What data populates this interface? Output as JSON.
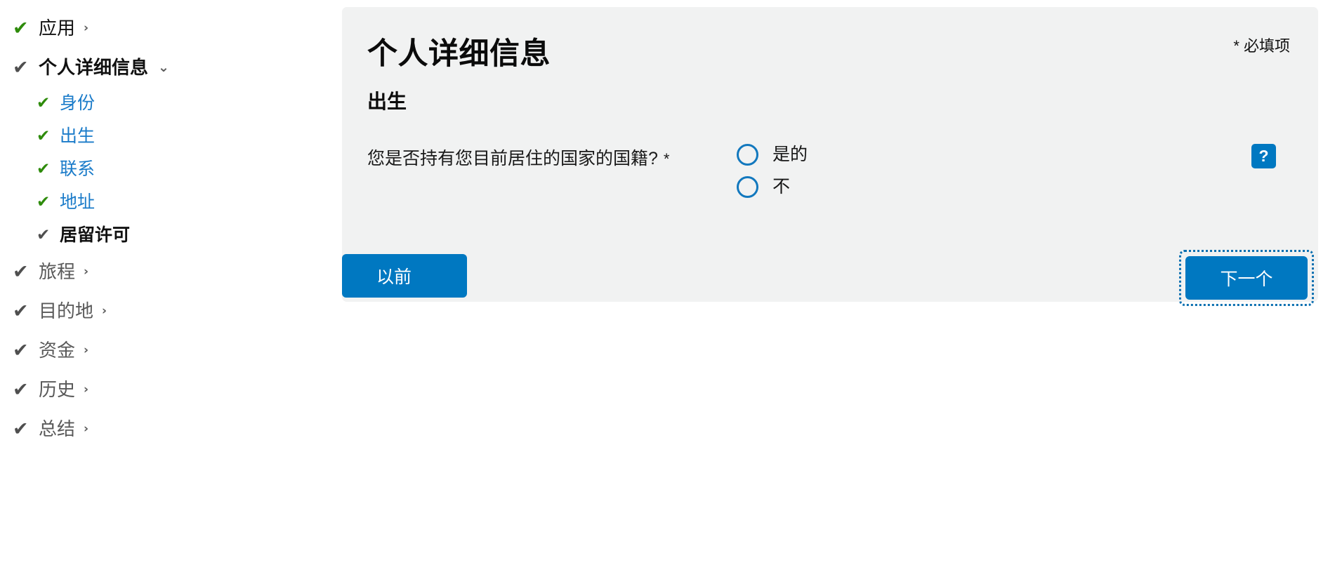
{
  "sidebar": {
    "items": [
      {
        "label": "应用",
        "check": "✔",
        "check_color": "green",
        "style": "dark",
        "chevron": "›",
        "level": 0
      },
      {
        "label": "个人详细信息",
        "check": "✔",
        "check_color": "grey",
        "style": "bold",
        "chevron": "⌄",
        "level": 0
      },
      {
        "label": "身份",
        "check": "✔",
        "check_color": "green",
        "style": "link",
        "chevron": "",
        "level": 1
      },
      {
        "label": "出生",
        "check": "✔",
        "check_color": "green",
        "style": "link",
        "chevron": "",
        "level": 1
      },
      {
        "label": "联系",
        "check": "✔",
        "check_color": "green",
        "style": "link",
        "chevron": "",
        "level": 1
      },
      {
        "label": "地址",
        "check": "✔",
        "check_color": "green",
        "style": "link",
        "chevron": "",
        "level": 1
      },
      {
        "label": "居留许可",
        "check": "✔",
        "check_color": "grey",
        "style": "active",
        "chevron": "",
        "level": 1
      },
      {
        "label": "旅程",
        "check": "✔",
        "check_color": "grey",
        "style": "grey",
        "chevron": "›",
        "level": 0
      },
      {
        "label": "目的地",
        "check": "✔",
        "check_color": "grey",
        "style": "grey",
        "chevron": "›",
        "level": 0
      },
      {
        "label": "资金",
        "check": "✔",
        "check_color": "grey",
        "style": "grey",
        "chevron": "›",
        "level": 0
      },
      {
        "label": "历史",
        "check": "✔",
        "check_color": "grey",
        "style": "grey",
        "chevron": "›",
        "level": 0
      },
      {
        "label": "总结",
        "check": "✔",
        "check_color": "grey",
        "style": "grey",
        "chevron": "›",
        "level": 0
      }
    ]
  },
  "panel": {
    "title": "个人详细信息",
    "subtitle": "出生",
    "required_note": "* 必填项",
    "question": {
      "text": "您是否持有您目前居住的国家的国籍?",
      "required_marker": "*",
      "options": [
        {
          "label": "是的",
          "selected": false
        },
        {
          "label": "不",
          "selected": false
        }
      ],
      "help_icon": "?"
    }
  },
  "footer": {
    "previous_label": "以前",
    "next_label": "下一个"
  },
  "colors": {
    "accent_blue": "#0078c1",
    "link_blue": "#1a7bc9",
    "check_green": "#2e8b0b",
    "check_grey": "#4f4f4f",
    "panel_bg": "#f1f2f2",
    "focus_outline": "#0b6fb0"
  }
}
